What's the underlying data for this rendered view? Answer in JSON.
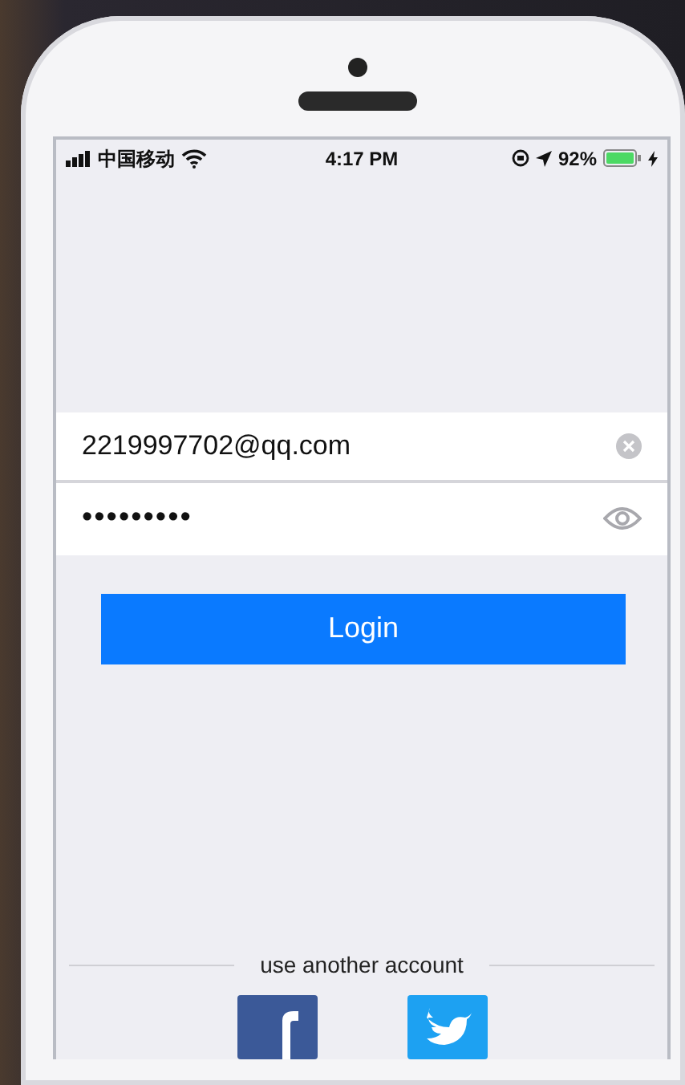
{
  "status_bar": {
    "carrier": "中国移动",
    "time": "4:17 PM",
    "battery": "92%"
  },
  "login_form": {
    "email": {
      "value": "2219997702@qq.com"
    },
    "password": {
      "value": "•••••••••"
    },
    "login_button": "Login"
  },
  "alternate_login": {
    "label": "use another account"
  }
}
